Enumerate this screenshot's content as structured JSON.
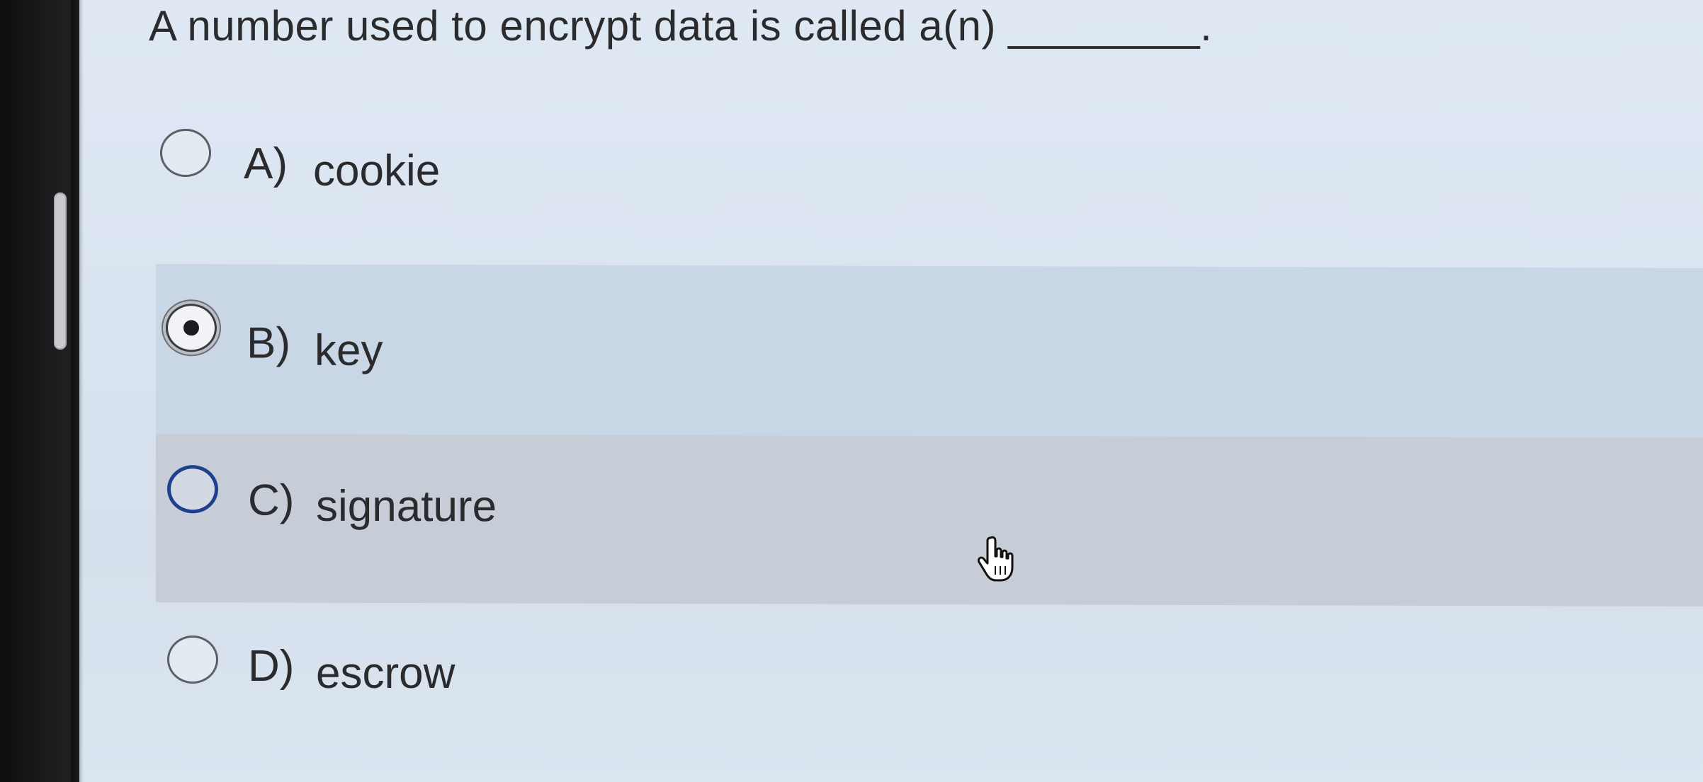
{
  "question": {
    "text": "A number used to encrypt data is called a(n) ________."
  },
  "options": [
    {
      "letter": "A)",
      "label": "cookie",
      "state": "unselected"
    },
    {
      "letter": "B)",
      "label": "key",
      "state": "selected"
    },
    {
      "letter": "C)",
      "label": "signature",
      "state": "hovered"
    },
    {
      "letter": "D)",
      "label": "escrow",
      "state": "unselected"
    }
  ],
  "icons": {
    "cursor": "hand-pointer-icon"
  },
  "colors": {
    "background": "#dae4f0",
    "selected_row": "#c9d6e6",
    "hover_row": "#c6cdd6",
    "focus_ring": "#1f3f8f",
    "text": "#2b2b2e"
  }
}
